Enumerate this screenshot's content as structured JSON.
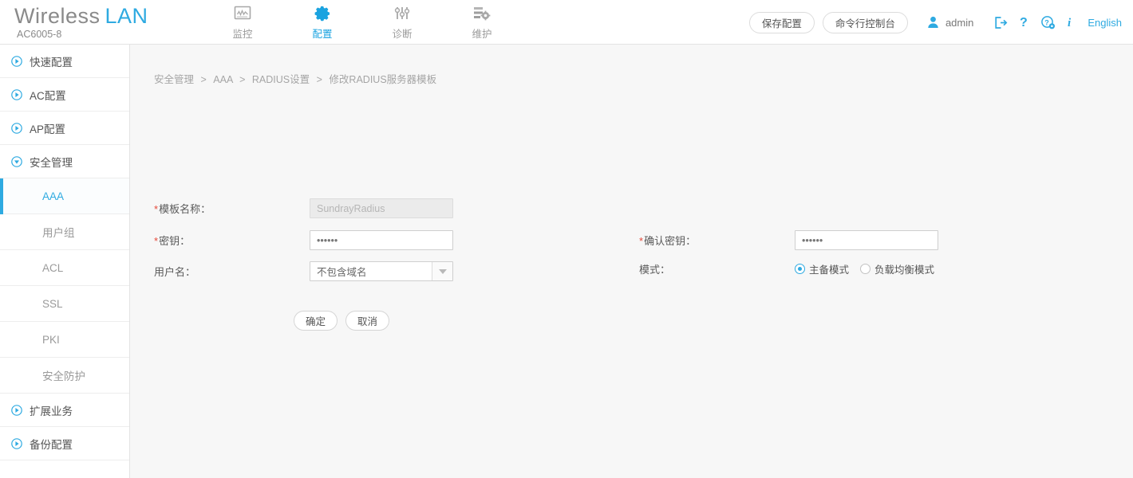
{
  "header": {
    "brand_name": "Wireless",
    "brand_accent": "LAN",
    "model": "AC6005-8",
    "nav": [
      {
        "label": "监控",
        "icon": "monitor-icon",
        "active": false
      },
      {
        "label": "配置",
        "icon": "gear-icon",
        "active": true
      },
      {
        "label": "诊断",
        "icon": "sliders-icon",
        "active": false
      },
      {
        "label": "维护",
        "icon": "maintenance-icon",
        "active": false
      }
    ],
    "save_config_label": "保存配置",
    "cli_console_label": "命令行控制台",
    "user_name": "admin",
    "icons": [
      "logout-icon",
      "help-icon",
      "support-icon",
      "info-icon"
    ],
    "language_label": "English"
  },
  "sidebar": {
    "items": [
      {
        "label": "快速配置",
        "type": "group",
        "expanded": false
      },
      {
        "label": "AC配置",
        "type": "group",
        "expanded": false
      },
      {
        "label": "AP配置",
        "type": "group",
        "expanded": false
      },
      {
        "label": "安全管理",
        "type": "group",
        "expanded": true
      },
      {
        "label": "AAA",
        "type": "sub",
        "active": true
      },
      {
        "label": "用户组",
        "type": "sub",
        "active": false
      },
      {
        "label": "ACL",
        "type": "sub",
        "active": false
      },
      {
        "label": "SSL",
        "type": "sub",
        "active": false
      },
      {
        "label": "PKI",
        "type": "sub",
        "active": false
      },
      {
        "label": "安全防护",
        "type": "sub",
        "active": false
      },
      {
        "label": "扩展业务",
        "type": "group",
        "expanded": false
      },
      {
        "label": "备份配置",
        "type": "group",
        "expanded": false
      }
    ]
  },
  "breadcrumb": {
    "items": [
      "安全管理",
      "AAA",
      "RADIUS设置",
      "修改RADIUS服务器模板"
    ],
    "separator": ">"
  },
  "form": {
    "template_name": {
      "label": "模板名称：",
      "value": "SundrayRadius",
      "required": true,
      "disabled": true
    },
    "secret": {
      "label": "密钥：",
      "value": "••••••",
      "required": true
    },
    "confirm_secret": {
      "label": "确认密钥：",
      "value": "••••••",
      "required": true
    },
    "username": {
      "label": "用户名：",
      "value": "不包含域名",
      "required": false
    },
    "mode": {
      "label": "模式：",
      "options": [
        {
          "label": "主备模式",
          "selected": true
        },
        {
          "label": "负载均衡模式",
          "selected": false
        }
      ]
    },
    "submit_label": "确定",
    "cancel_label": "取消"
  },
  "colors": {
    "accent": "#2eaae1",
    "required": "#e64a3b",
    "content_bg": "#f7f7f7",
    "text": "#666666"
  }
}
